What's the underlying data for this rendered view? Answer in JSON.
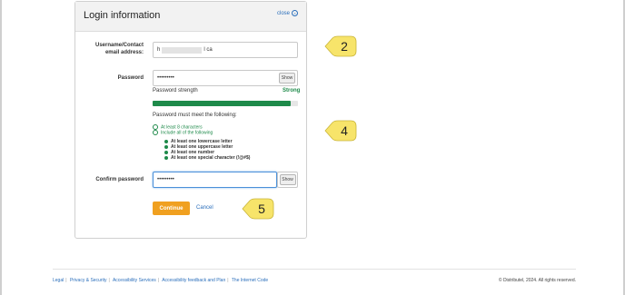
{
  "panel": {
    "title": "Login information",
    "close_label": "close"
  },
  "username": {
    "label_line1": "Username/Contact",
    "label_line2": "email address:",
    "value_prefix": "h",
    "value_suffix": "l ca"
  },
  "password": {
    "label": "Password",
    "masked_value": "•••••••••",
    "show_label": "Show"
  },
  "strength": {
    "label": "Password strength",
    "value": "Strong",
    "fill_fraction": 0.95
  },
  "requirements": {
    "intro": "Password must meet the following:",
    "items_green": [
      "At least 8 characters",
      "Include all of the following"
    ],
    "sub_items": [
      "At least one lowercase letter",
      "At least one uppercase letter",
      "At least one number",
      "At least one special character (!@#$)"
    ]
  },
  "confirm": {
    "label": "Confirm password",
    "masked_value": "•••••••••",
    "show_label": "Show"
  },
  "actions": {
    "continue_label": "Continue",
    "cancel_label": "Cancel"
  },
  "callouts": [
    "2",
    "4",
    "5"
  ],
  "footer": {
    "links": [
      "Legal",
      "Privacy & Security",
      "Accessibility Services",
      "Accessibility feedback and Plan",
      "The Internet Code"
    ],
    "copyright": "© Distributel, 2024. All rights reserved."
  },
  "colors": {
    "accent": "#f0a020",
    "link": "#2a6ebb",
    "success": "#1e8a4a",
    "callout": "#f7e46a"
  }
}
